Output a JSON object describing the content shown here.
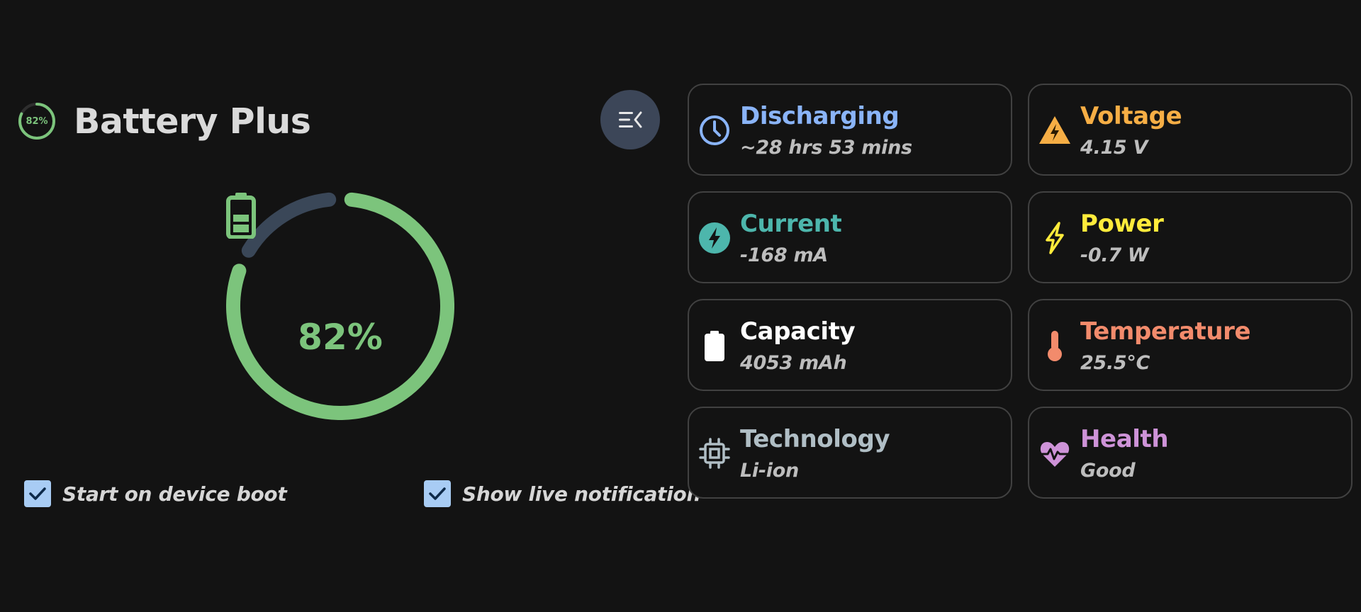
{
  "app": {
    "title": "Battery Plus",
    "mini_indicator_text": "82%",
    "menu_icon": "menu-collapse-icon"
  },
  "gauge": {
    "percent_text": "82%",
    "level_fraction": 0.82,
    "icon": "battery-icon",
    "colors": {
      "fill": "#7cc47c",
      "track": "#3a4758"
    }
  },
  "options": {
    "start_on_boot": {
      "label": "Start on device boot",
      "checked": true
    },
    "live_notification": {
      "label": "Show live notification",
      "checked": true
    }
  },
  "cards": [
    {
      "title": "Discharging",
      "value": "~28 hrs 53 mins",
      "icon": "clock-icon",
      "color": "#8ab4f8"
    },
    {
      "title": "Voltage",
      "value": "4.15 V",
      "icon": "warning-bolt-icon",
      "color": "#f6ae45"
    },
    {
      "title": "Current",
      "value": "-168 mA",
      "icon": "bolt-circle-icon",
      "color": "#4db6ac"
    },
    {
      "title": "Power",
      "value": "-0.7 W",
      "icon": "lightning-icon",
      "color": "#ffeb3b"
    },
    {
      "title": "Capacity",
      "value": "4053 mAh",
      "icon": "battery-full-icon",
      "color": "#ffffff"
    },
    {
      "title": "Temperature",
      "value": "25.5°C",
      "icon": "thermometer-icon",
      "color": "#f28b6c"
    },
    {
      "title": "Technology",
      "value": "Li-ion",
      "icon": "chip-icon",
      "color": "#b0bec5"
    },
    {
      "title": "Health",
      "value": "Good",
      "icon": "heart-pulse-icon",
      "color": "#ce93d8"
    }
  ]
}
